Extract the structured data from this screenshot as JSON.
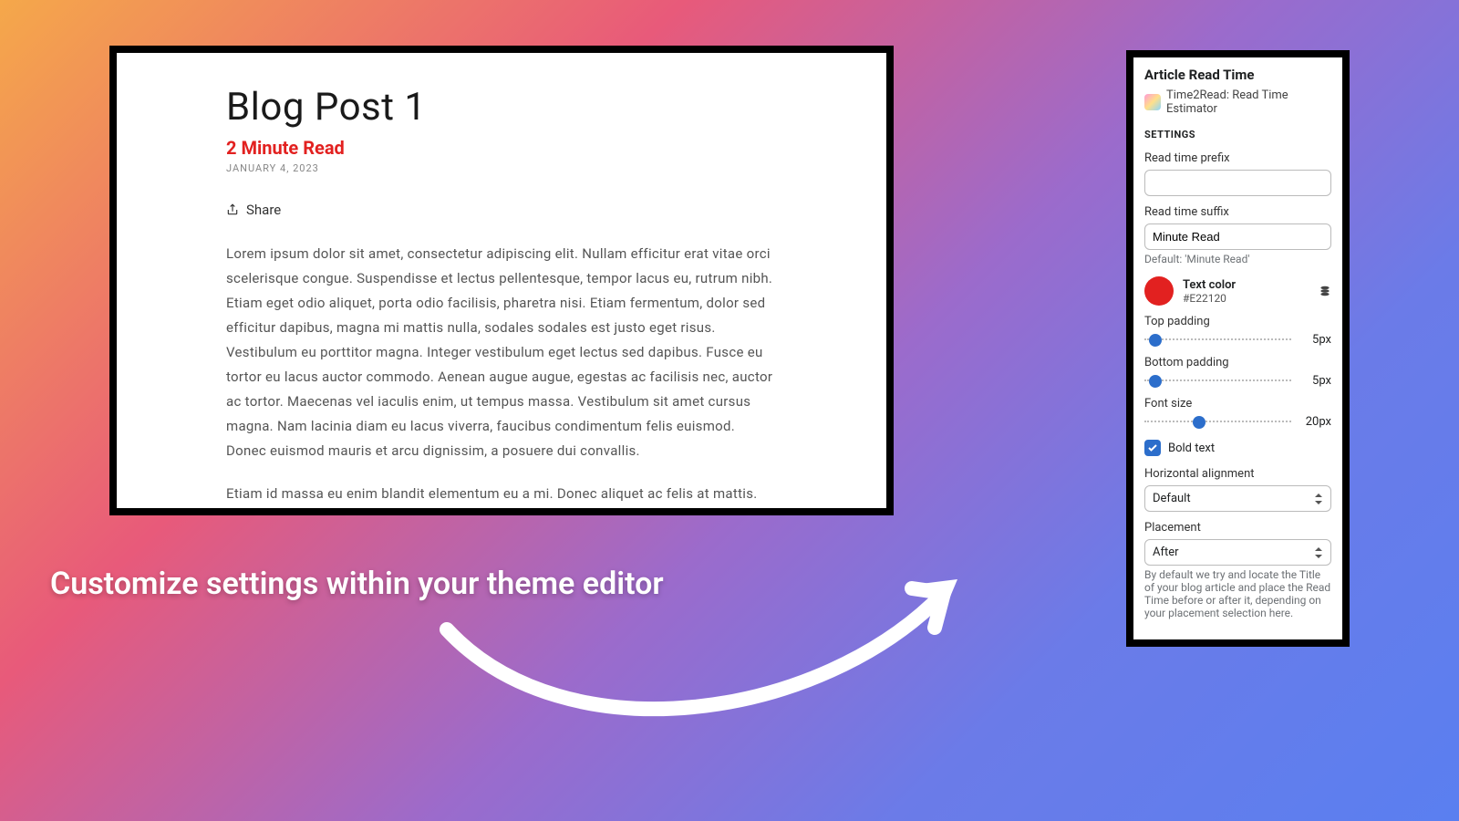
{
  "caption": "Customize settings within your theme editor",
  "blog": {
    "title": "Blog Post 1",
    "read_time": "2 Minute Read",
    "date": "JANUARY 4, 2023",
    "share_label": "Share",
    "body_p1": "Lorem ipsum dolor sit amet, consectetur adipiscing elit. Nullam efficitur erat vitae orci scelerisque congue. Suspendisse et lectus pellentesque, tempor lacus eu, rutrum nibh. Etiam eget odio aliquet, porta odio facilisis, pharetra nisi. Etiam fermentum, dolor sed efficitur dapibus, magna mi mattis nulla, sodales sodales est justo eget risus. Vestibulum eu porttitor magna. Integer vestibulum eget lectus sed dapibus. Fusce eu tortor eu lacus auctor commodo. Aenean augue augue, egestas ac facilisis nec, auctor ac tortor. Maecenas vel iaculis enim, ut tempus massa. Vestibulum sit amet cursus magna. Nam lacinia diam eu lacus viverra, faucibus condimentum felis euismod. Donec euismod mauris et arcu dignissim, a posuere dui convallis.",
    "body_p2": "Etiam id massa eu enim blandit elementum eu a mi. Donec aliquet ac felis at mattis. Fusce blandit eget elit sit amet ullamcorper. Aliquam et porttitor justo. Donec eu dictum risus. Phasellus luctus nisl fringilla ultrices dictum. Nunc rhoncus magna id erat fringilla venenatis. Praesent quis ligula dictum massa tristique gravida quis dignissim eros. Fusce dictum arcu eu lacus tristique rhoncus. Nunc lacus"
  },
  "panel": {
    "title": "Article Read Time",
    "app_name": "Time2Read: Read Time Estimator",
    "section": "SETTINGS",
    "prefix_label": "Read time prefix",
    "prefix_value": "",
    "suffix_label": "Read time suffix",
    "suffix_value": "Minute Read",
    "suffix_helper": "Default: 'Minute Read'",
    "color_label": "Text color",
    "color_hex": "#E22120",
    "top_pad_label": "Top padding",
    "top_pad_value": "5px",
    "bot_pad_label": "Bottom padding",
    "bot_pad_value": "5px",
    "font_label": "Font size",
    "font_value": "20px",
    "bold_label": "Bold text",
    "align_label": "Horizontal alignment",
    "align_value": "Default",
    "place_label": "Placement",
    "place_value": "After",
    "place_helper": "By default we try and locate the Title of your blog article and place the Read Time before or after it, depending on your placement selection here."
  }
}
